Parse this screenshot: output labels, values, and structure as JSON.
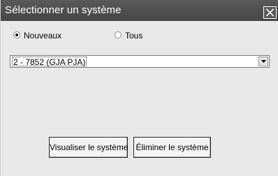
{
  "window": {
    "title": "Sélectionner un système"
  },
  "radios": [
    {
      "label": "Nouveaux",
      "checked": true
    },
    {
      "label": "Tous",
      "checked": false
    }
  ],
  "system_select": {
    "value": "2 - 7852 (GJA PJA)"
  },
  "buttons": {
    "visualize_label": "Visualiser le système",
    "delete_label": "Éliminer le système"
  },
  "icons": {
    "close": "close-icon",
    "dropdown": "chevron-down-icon"
  }
}
